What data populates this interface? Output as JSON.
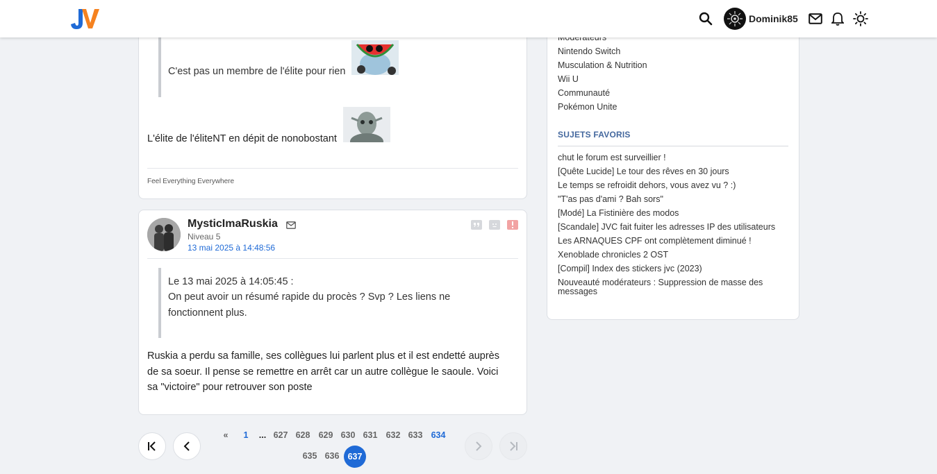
{
  "header": {
    "username": "Dominik85"
  },
  "post_prev": {
    "quote_text": "C'est pas un membre de l'élite pour rien",
    "body_text": "L'élite de l'éliteNT en dépit de nonobostant",
    "signature": "Feel Everything Everywhere"
  },
  "post": {
    "author": "MysticImaRuskia",
    "level": "Niveau 5",
    "date": "13 mai 2025 à 14:48:56",
    "quote_header": "Le 13 mai 2025 à 14:05:45 :",
    "quote_line1": "On peut avoir un résumé rapide du procès ? Svp ? Les liens ne",
    "quote_line2": "fonctionnent plus.",
    "body_line1": "Ruskia a perdu sa famille, ses collègues lui parlent plus et il est endetté auprès",
    "body_line2": "de sa soeur. Il pense se remettre en arrêt car un autre collègue le saoule. Voici",
    "body_line3": "sa \"victoire\" pour retrouver son poste"
  },
  "sidebar": {
    "forums": [
      "Modérateurs",
      "Nintendo Switch",
      "Musculation & Nutrition",
      "Wii U",
      "Communauté",
      "Pokémon Unite"
    ],
    "favorites_title": "SUJETS FAVORIS",
    "topics": [
      "chut le forum est surveillier !",
      "[Quête Lucide] Le tour des rêves en 30 jours",
      "Le temps se refroidit dehors, vous avez vu ? :)",
      "\"T'as pas d'ami ? Bah sors\"",
      "[Modé] La Fistinière des modos",
      "[Scandale] JVC fait fuiter les adresses IP des utilisateurs",
      "Les ARNAQUES CPF ont complètement diminué !",
      "Xenoblade chronicles 2 OST",
      "[Compil] Index des stickers jvc (2023)",
      "Nouveauté modérateurs : Suppression de masse des messages"
    ]
  },
  "pagination": {
    "prev_marker": "«",
    "first": "1",
    "ellipsis": "...",
    "pages_row1": [
      "627",
      "628",
      "629",
      "630",
      "631",
      "632",
      "633",
      "634"
    ],
    "pages_row2": [
      "635",
      "636"
    ],
    "current": "637"
  },
  "colors": {
    "accent": "#1f6ad6",
    "logo_blue": "#1f6ad6",
    "logo_orange": "#f58220"
  }
}
